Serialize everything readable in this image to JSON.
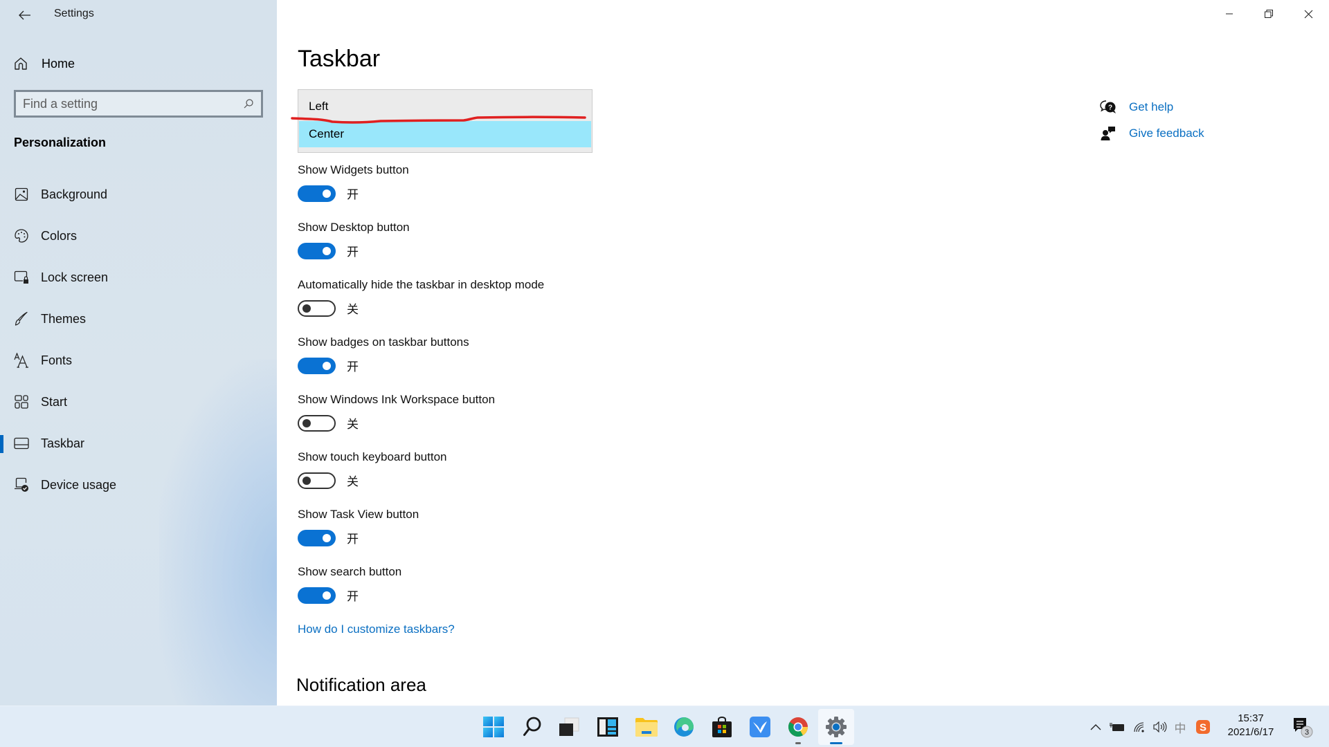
{
  "window": {
    "title": "Settings",
    "controls": {
      "minimize": "minimize",
      "restore": "restore",
      "close": "close"
    }
  },
  "sidebar": {
    "home_label": "Home",
    "search": {
      "placeholder": "Find a setting",
      "value": ""
    },
    "section_title": "Personalization",
    "items": [
      {
        "label": "Background",
        "icon": "image-icon",
        "active": false
      },
      {
        "label": "Colors",
        "icon": "palette-icon",
        "active": false
      },
      {
        "label": "Lock screen",
        "icon": "lock-screen-icon",
        "active": false
      },
      {
        "label": "Themes",
        "icon": "brush-icon",
        "active": false
      },
      {
        "label": "Fonts",
        "icon": "fonts-icon",
        "active": false
      },
      {
        "label": "Start",
        "icon": "start-icon",
        "active": false
      },
      {
        "label": "Taskbar",
        "icon": "taskbar-icon",
        "active": true
      },
      {
        "label": "Device usage",
        "icon": "device-usage-icon",
        "active": false
      }
    ]
  },
  "main": {
    "title": "Taskbar",
    "alignment_dropdown": {
      "options": [
        "Left",
        "Center"
      ],
      "highlighted": "Center",
      "annotation_color": "#e02020"
    },
    "settings": [
      {
        "label": "Show Widgets button",
        "on": true,
        "state_text": "开"
      },
      {
        "label": "Show Desktop button",
        "on": true,
        "state_text": "开"
      },
      {
        "label": "Automatically hide the taskbar in desktop mode",
        "on": false,
        "state_text": "关"
      },
      {
        "label": "Show badges on taskbar buttons",
        "on": true,
        "state_text": "开"
      },
      {
        "label": "Show Windows Ink Workspace button",
        "on": false,
        "state_text": "关"
      },
      {
        "label": "Show touch keyboard button",
        "on": false,
        "state_text": "关"
      },
      {
        "label": "Show Task View button",
        "on": true,
        "state_text": "开"
      },
      {
        "label": "Show search button",
        "on": true,
        "state_text": "开"
      }
    ],
    "help_link": "How do I customize taskbars?",
    "next_section_title": "Notification area",
    "side_links": {
      "get_help": "Get help",
      "give_feedback": "Give feedback"
    }
  },
  "colors": {
    "accent": "#0a72d3",
    "link": "#0a6fc2",
    "dropdown_highlight": "#99e7fb"
  },
  "taskbar": {
    "apps": [
      {
        "name": "start",
        "icon": "windows-start-icon"
      },
      {
        "name": "search",
        "icon": "search-icon"
      },
      {
        "name": "task-view",
        "icon": "task-view-icon"
      },
      {
        "name": "widgets",
        "icon": "widgets-icon"
      },
      {
        "name": "file-explorer",
        "icon": "folder-icon"
      },
      {
        "name": "edge",
        "icon": "edge-icon"
      },
      {
        "name": "store",
        "icon": "store-icon"
      },
      {
        "name": "feishu",
        "icon": "bird-app-icon"
      },
      {
        "name": "chrome",
        "icon": "chrome-icon",
        "running": true
      },
      {
        "name": "settings",
        "icon": "settings-gear-icon",
        "active": true
      }
    ],
    "tray": {
      "time": "15:37",
      "date": "2021/6/17",
      "ime": "中",
      "notification_count": "3"
    }
  }
}
